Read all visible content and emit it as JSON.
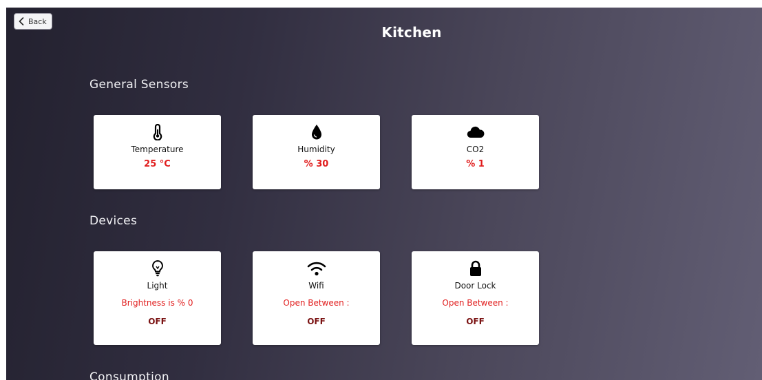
{
  "header": {
    "back_label": "Back",
    "title": "Kitchen"
  },
  "sections": {
    "general_sensors": "General Sensors",
    "devices": "Devices",
    "consumption": "Consumption"
  },
  "sensors": [
    {
      "label": "Temperature",
      "value": "25 °C",
      "icon": "thermometer-icon"
    },
    {
      "label": "Humidity",
      "value": "% 30",
      "icon": "water-drop-icon"
    },
    {
      "label": "CO2",
      "value": "% 1",
      "icon": "cloud-icon"
    }
  ],
  "devices": [
    {
      "label": "Light",
      "status": "Brightness is % 0",
      "state": "OFF",
      "icon": "lightbulb-icon"
    },
    {
      "label": "Wifi",
      "status": "Open Between :",
      "state": "OFF",
      "icon": "wifi-icon"
    },
    {
      "label": "Door Lock",
      "status": "Open Between :",
      "state": "OFF",
      "icon": "lock-icon"
    }
  ],
  "colors": {
    "value_red": "#e11d1d",
    "state_dark_red": "#7a1212",
    "card_bg": "#ffffff"
  }
}
